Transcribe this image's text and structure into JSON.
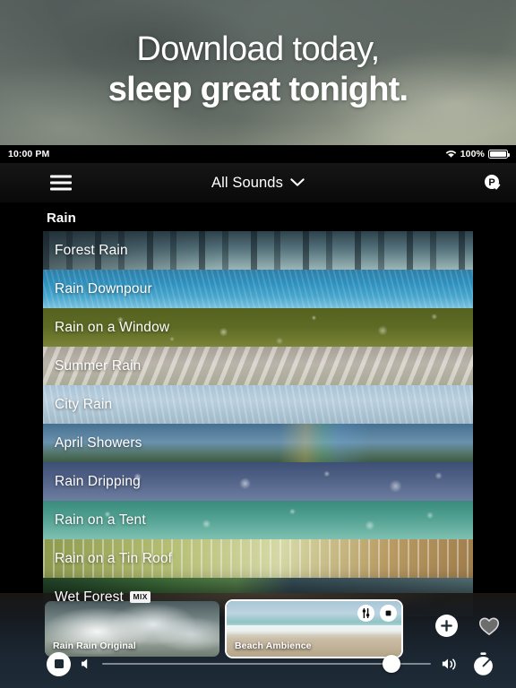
{
  "promo": {
    "line1": "Download today,",
    "line2": "sleep great tonight."
  },
  "status_bar": {
    "time": "10:00 PM",
    "battery_percent": "100%",
    "wifi_icon": "wifi-icon",
    "battery_icon": "battery-full-icon"
  },
  "nav": {
    "menu_icon": "hamburger-menu-icon",
    "title": "All Sounds",
    "chevron": "⌄",
    "pro_badge_label": "P",
    "pro_badge_icon": "pro-check-badge-icon"
  },
  "section": {
    "title": "Rain"
  },
  "sounds": [
    {
      "name": "Forest Rain",
      "art": "art-forest",
      "badge": ""
    },
    {
      "name": "Rain Downpour",
      "art": "art-downpour",
      "badge": ""
    },
    {
      "name": "Rain on a Window",
      "art": "art-window",
      "badge": ""
    },
    {
      "name": "Summer Rain",
      "art": "art-summer",
      "badge": ""
    },
    {
      "name": "City Rain",
      "art": "art-city",
      "badge": ""
    },
    {
      "name": "April Showers",
      "art": "art-april",
      "badge": ""
    },
    {
      "name": "Rain Dripping",
      "art": "art-dripping",
      "badge": ""
    },
    {
      "name": "Rain on a Tent",
      "art": "art-tent",
      "badge": ""
    },
    {
      "name": "Rain on a Tin Roof",
      "art": "art-tinroof",
      "badge": ""
    },
    {
      "name": "Wet Forest",
      "art": "art-wetforest",
      "badge": "MIX"
    }
  ],
  "player": {
    "cards": [
      {
        "name": "Rain Rain Original",
        "art": "cbg-clouds",
        "active": false
      },
      {
        "name": "Beach Ambience",
        "art": "cbg-beach",
        "active": true
      }
    ],
    "card_buttons": {
      "mixer_icon": "sliders-icon",
      "stop_icon": "stop-square-icon"
    },
    "add_button_icon": "plus-icon",
    "favorite_button_icon": "heart-outline-icon",
    "stop_button_icon": "stop-square-icon",
    "volume_low_icon": "speaker-low-icon",
    "volume_high_icon": "speaker-high-icon",
    "timer_button_icon": "stopwatch-icon",
    "volume_percent": 88
  },
  "colors": {
    "accent_white": "#ffffff",
    "dock_bg": "#1e2c38",
    "app_bg": "#000000",
    "nav_bg": "#0e0e0e"
  }
}
